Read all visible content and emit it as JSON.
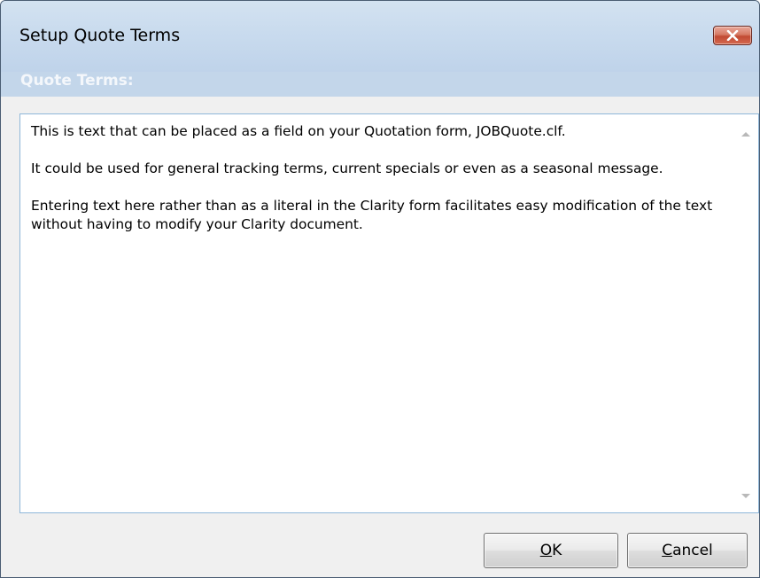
{
  "window": {
    "title": "Setup Quote Terms"
  },
  "label": {
    "quote_terms": "Quote Terms:"
  },
  "terms_text": {
    "para1": "This is text that can be placed as a field on your Quotation form, JOBQuote.clf.",
    "para2": "It could be used for general tracking terms, current specials or even as a seasonal message.",
    "para3": "Entering text here rather than as a literal in the Clarity form facilitates easy modification of the text without having to modify your Clarity document."
  },
  "buttons": {
    "ok_accel": "O",
    "ok_rest": "K",
    "cancel_accel": "C",
    "cancel_rest": "ancel"
  },
  "icons": {
    "close": "close-icon",
    "scroll_up": "scroll-up-arrow-icon",
    "scroll_down": "scroll-down-arrow-icon"
  },
  "colors": {
    "titlebar": "#c9dbee",
    "close_button": "#c14a33",
    "dialog_body": "#f0f0f0",
    "textbox_border": "#8fb7d9"
  }
}
